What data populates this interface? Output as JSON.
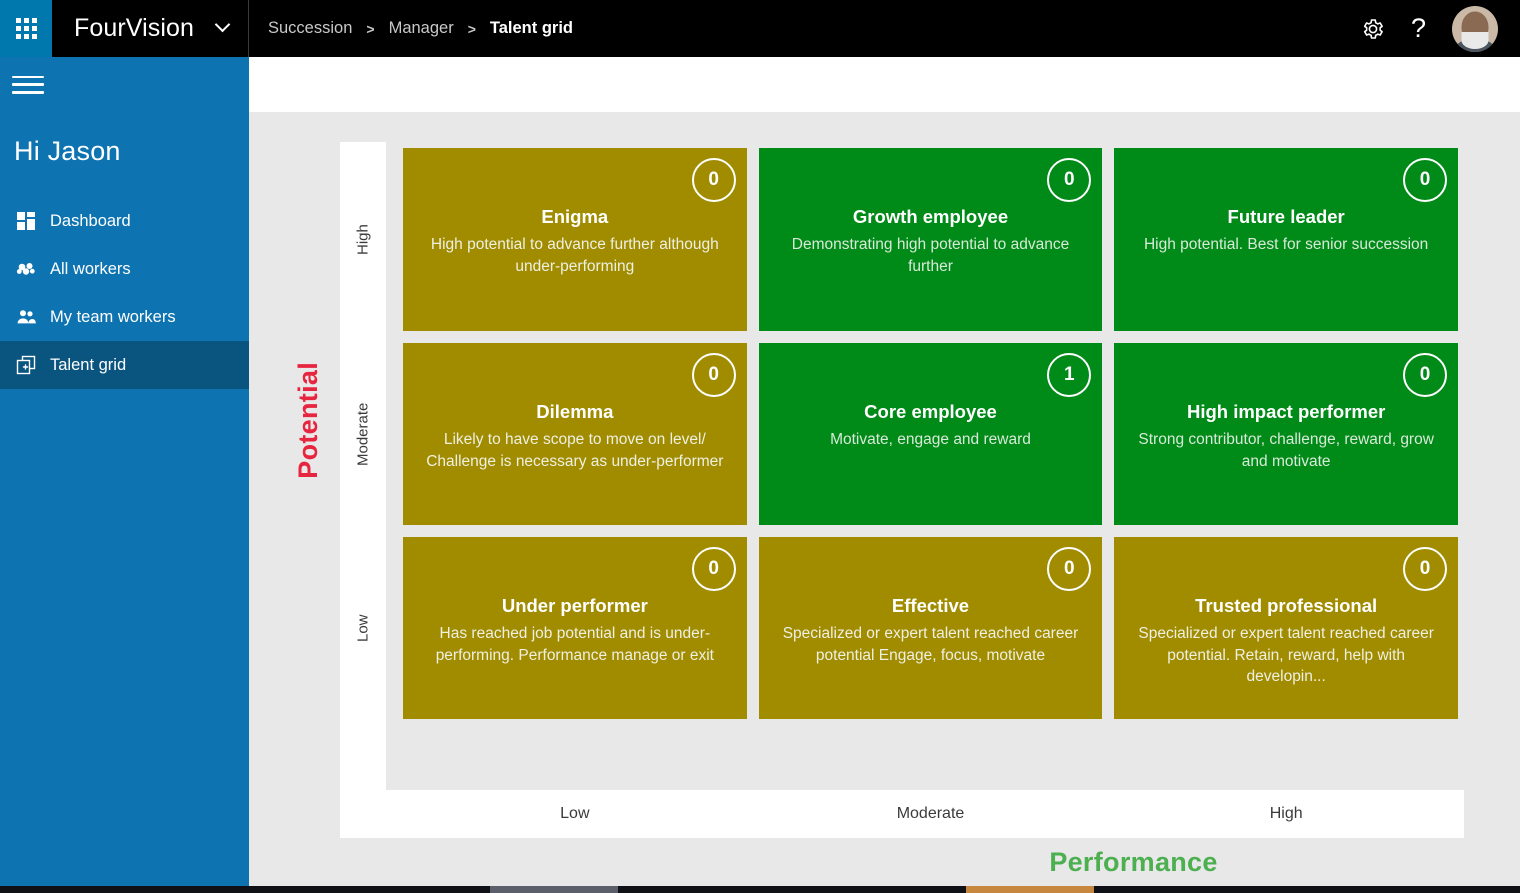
{
  "topbar": {
    "waffle_icon": "app-launcher-icon",
    "brand": "FourVision",
    "brand_chevron_icon": "chevron-down-icon",
    "breadcrumb": [
      "Succession",
      "Manager",
      "Talent grid"
    ],
    "breadcrumb_separator": ">",
    "gear_icon": "gear-icon",
    "help_label": "?",
    "avatar_icon": "user-avatar"
  },
  "sidebar": {
    "hamburger_icon": "hamburger-menu-icon",
    "greeting": "Hi Jason",
    "items": [
      {
        "label": "Dashboard",
        "icon": "dashboard-icon",
        "active": false
      },
      {
        "label": "All workers",
        "icon": "all-workers-icon",
        "active": false
      },
      {
        "label": "My team workers",
        "icon": "my-team-workers-icon",
        "active": false
      },
      {
        "label": "Talent grid",
        "icon": "talent-grid-icon",
        "active": true
      }
    ]
  },
  "colors": {
    "brand_blue": "#0d73b1",
    "sidebar_active": "#0a5480",
    "gold": "#a18c00",
    "green": "#008a18",
    "potential_label": "#e8253f",
    "performance_label": "#4caf50",
    "page_background": "#e8e8e8"
  },
  "chart_data": {
    "type": "heatmap",
    "title": "Talent grid",
    "xlabel": "Performance",
    "ylabel": "Potential",
    "x_categories": [
      "Low",
      "Moderate",
      "High"
    ],
    "y_categories": [
      "High",
      "Moderate",
      "Low"
    ],
    "legend": [],
    "grid": false,
    "cells": [
      {
        "row": "High",
        "col": "Low",
        "title": "Enigma",
        "desc": "High potential to advance further although under-performing",
        "count": "0",
        "color": "#a18c00",
        "tone": "gold"
      },
      {
        "row": "High",
        "col": "Moderate",
        "title": "Growth employee",
        "desc": "Demonstrating high potential to advance further",
        "count": "0",
        "color": "#008a18",
        "tone": "green"
      },
      {
        "row": "High",
        "col": "High",
        "title": "Future leader",
        "desc": "High potential. Best for senior succession",
        "count": "0",
        "color": "#008a18",
        "tone": "green"
      },
      {
        "row": "Moderate",
        "col": "Low",
        "title": "Dilemma",
        "desc": "Likely to have scope to move on level/ Challenge is necessary as under-performer",
        "count": "0",
        "color": "#a18c00",
        "tone": "gold"
      },
      {
        "row": "Moderate",
        "col": "Moderate",
        "title": "Core employee",
        "desc": "Motivate, engage and reward",
        "count": "1",
        "color": "#008a18",
        "tone": "green"
      },
      {
        "row": "Moderate",
        "col": "High",
        "title": "High impact performer",
        "desc": "Strong contributor, challenge, reward, grow and motivate",
        "count": "0",
        "color": "#008a18",
        "tone": "green"
      },
      {
        "row": "Low",
        "col": "Low",
        "title": "Under performer",
        "desc": "Has reached job potential and is under-performing. Performance manage or exit",
        "count": "0",
        "color": "#a18c00",
        "tone": "gold"
      },
      {
        "row": "Low",
        "col": "Moderate",
        "title": "Effective",
        "desc": "Specialized or expert talent reached career potential Engage, focus, motivate",
        "count": "0",
        "color": "#a18c00",
        "tone": "gold"
      },
      {
        "row": "Low",
        "col": "High",
        "title": "Trusted professional",
        "desc": "Specialized or expert talent reached career potential. Retain, reward, help with developin...",
        "count": "0",
        "color": "#a18c00",
        "tone": "gold"
      }
    ]
  }
}
